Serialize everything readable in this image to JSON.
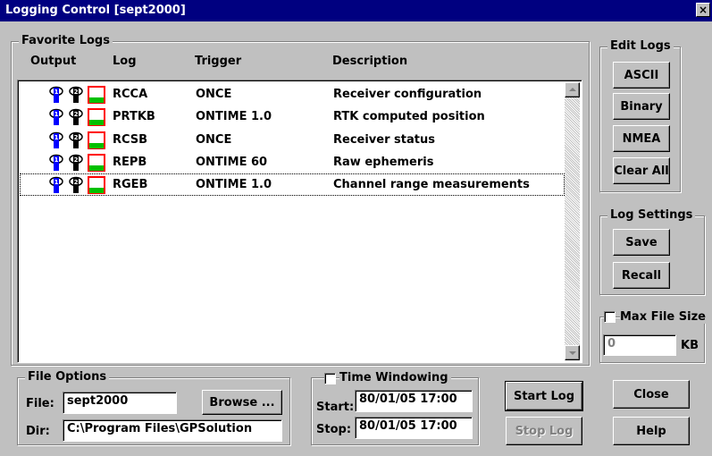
{
  "window": {
    "title": "Logging Control [sept2000]",
    "close_glyph": "×"
  },
  "favorite_logs": {
    "group_label": "Favorite Logs",
    "columns": {
      "output": "Output",
      "log": "Log",
      "trigger": "Trigger",
      "description": "Description"
    },
    "rows": [
      {
        "log": "RCCA",
        "trigger": "ONCE",
        "description": "Receiver configuration"
      },
      {
        "log": "PRTKB",
        "trigger": "ONTIME 1.0",
        "description": "RTK computed position"
      },
      {
        "log": "RCSB",
        "trigger": "ONCE",
        "description": "Receiver status"
      },
      {
        "log": "REPB",
        "trigger": "ONTIME 60",
        "description": "Raw ephemeris"
      },
      {
        "log": "RGEB",
        "trigger": "ONTIME 1.0",
        "description": "Channel range measurements"
      }
    ],
    "output_icons": [
      "port1-icon",
      "port2-icon",
      "file-icon"
    ]
  },
  "edit_logs": {
    "group_label": "Edit Logs",
    "ascii_label": "ASCII",
    "binary_label": "Binary",
    "nmea_label": "NMEA",
    "clear_all_label": "Clear All"
  },
  "log_settings": {
    "group_label": "Log Settings",
    "save_label": "Save",
    "recall_label": "Recall"
  },
  "max_file_size": {
    "label": "Max File Size",
    "value": "0",
    "unit": "KB",
    "checked": false
  },
  "file_options": {
    "group_label": "File Options",
    "file_label": "File:",
    "file_value": "sept2000",
    "browse_label": "Browse ...",
    "dir_label": "Dir:",
    "dir_value": "C:\\Program Files\\GPSolution"
  },
  "time_windowing": {
    "label": "Time Windowing",
    "checked": false,
    "start_label": "Start:",
    "start_value": "80/01/05 17:00",
    "stop_label": "Stop:",
    "stop_value": "80/01/05 17:00"
  },
  "actions": {
    "start_log_label": "Start Log",
    "stop_log_label": "Stop Log",
    "close_label": "Close",
    "help_label": "Help"
  },
  "colors": {
    "titlebar": "#000080",
    "port1_blue": "#0000ff",
    "file_green": "#00c000",
    "file_red": "#ff0000"
  }
}
